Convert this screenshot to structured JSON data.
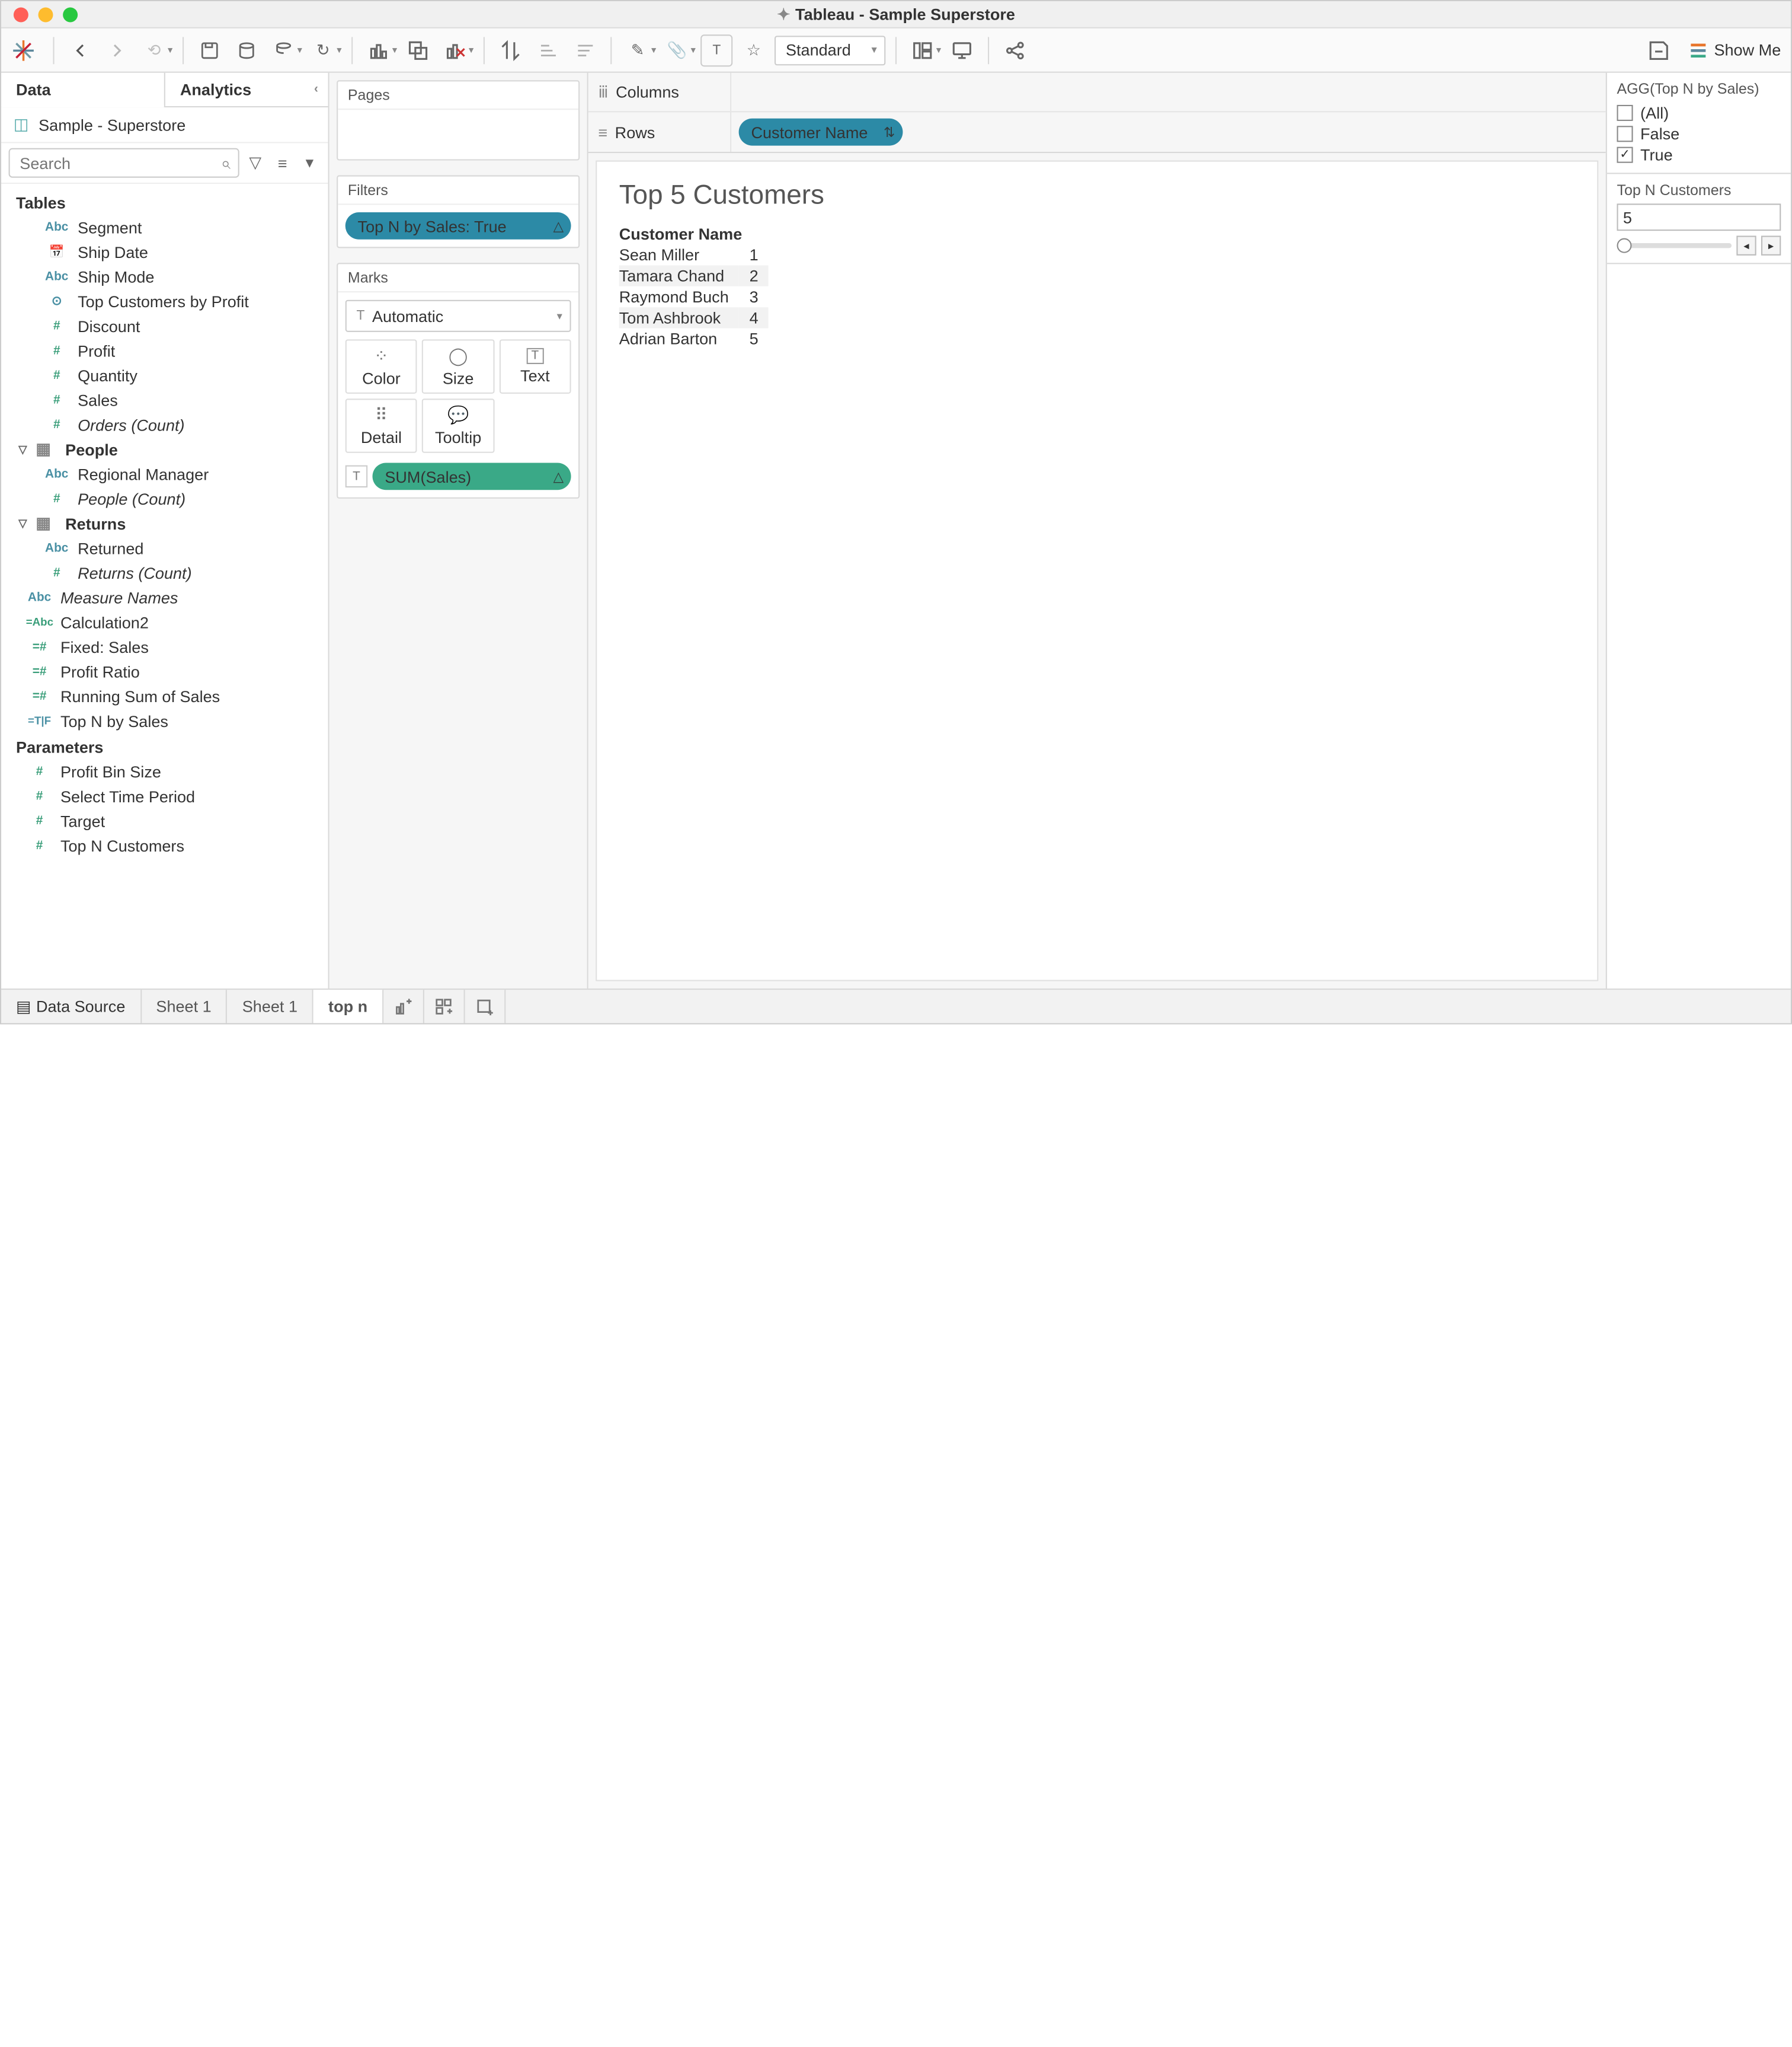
{
  "window": {
    "title": "Tableau - Sample Superstore"
  },
  "toolbar": {
    "fit": "Standard",
    "showme": "Show Me"
  },
  "data_tabs": {
    "data": "Data",
    "analytics": "Analytics"
  },
  "datasource": "Sample - Superstore",
  "search_placeholder": "Search",
  "sections": {
    "tables": "Tables",
    "people": "People",
    "returns": "Returns",
    "parameters": "Parameters"
  },
  "fields": {
    "segment": "Segment",
    "ship_date": "Ship Date",
    "ship_mode": "Ship Mode",
    "top_customers_by_profit": "Top Customers by Profit",
    "discount": "Discount",
    "profit": "Profit",
    "quantity": "Quantity",
    "sales": "Sales",
    "orders_count": "Orders (Count)",
    "regional_manager": "Regional Manager",
    "people_count": "People (Count)",
    "returned": "Returned",
    "returns_count": "Returns (Count)",
    "measure_names": "Measure Names",
    "calculation2": "Calculation2",
    "fixed_sales": "Fixed: Sales",
    "profit_ratio": "Profit Ratio",
    "running_sum": "Running Sum of Sales",
    "top_n_by_sales": "Top N by Sales"
  },
  "params": {
    "profit_bin_size": "Profit Bin Size",
    "select_time_period": "Select Time Period",
    "target": "Target",
    "top_n_customers": "Top N Customers"
  },
  "cards": {
    "pages": "Pages",
    "filters": "Filters",
    "marks": "Marks",
    "mark_type": "Automatic",
    "color": "Color",
    "size": "Size",
    "text": "Text",
    "detail": "Detail",
    "tooltip": "Tooltip"
  },
  "filter_pill": "Top N by Sales: True",
  "mark_pill": "SUM(Sales)",
  "shelves": {
    "columns": "Columns",
    "rows": "Rows",
    "row_pill": "Customer Name"
  },
  "viz": {
    "title": "Top 5 Customers",
    "header": "Customer Name",
    "rows": [
      {
        "name": "Sean Miller",
        "n": "1"
      },
      {
        "name": "Tamara Chand",
        "n": "2"
      },
      {
        "name": "Raymond Buch",
        "n": "3"
      },
      {
        "name": "Tom Ashbrook",
        "n": "4"
      },
      {
        "name": "Adrian Barton",
        "n": "5"
      }
    ]
  },
  "right": {
    "agg_title": "AGG(Top N by Sales)",
    "all": "(All)",
    "false": "False",
    "true": "True",
    "param_title": "Top N Customers",
    "param_value": "5"
  },
  "bottom": {
    "data_source": "Data Source",
    "sheet1a": "Sheet 1",
    "sheet1b": "Sheet 1",
    "topn": "top n"
  }
}
